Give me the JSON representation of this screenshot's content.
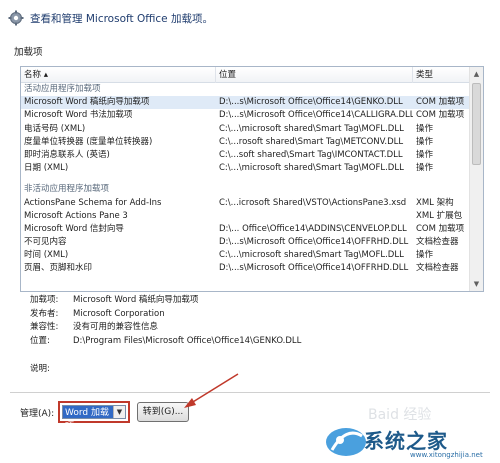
{
  "header": {
    "title": "查看和管理 Microsoft Office 加载项。",
    "icon": "gear-icon"
  },
  "section_label": "加载项",
  "columns": [
    "名称 ▴",
    "位置",
    "类型"
  ],
  "groups": [
    {
      "label": "活动应用程序加载项",
      "rows": [
        {
          "name": "Microsoft Word 稿纸向导加载项",
          "location": "D:\\...s\\Microsoft Office\\Office14\\GENKO.DLL",
          "type": "COM 加载项",
          "selected": true
        },
        {
          "name": "Microsoft Word 书法加载项",
          "location": "D:\\...s\\Microsoft Office\\Office14\\CALLIGRA.DLL",
          "type": "COM 加载项"
        },
        {
          "name": "电话号码 (XML)",
          "location": "C:\\...\\microsoft shared\\Smart Tag\\MOFL.DLL",
          "type": "操作"
        },
        {
          "name": "度量单位转换器 (度量单位转换器)",
          "location": "C:\\...rosoft shared\\Smart Tag\\METCONV.DLL",
          "type": "操作"
        },
        {
          "name": "即时消息联系人 (英语)",
          "location": "C:\\...soft shared\\Smart Tag\\IMCONTACT.DLL",
          "type": "操作"
        },
        {
          "name": "日期 (XML)",
          "location": "C:\\...\\microsoft shared\\Smart Tag\\MOFL.DLL",
          "type": "操作"
        }
      ]
    },
    {
      "label": "非活动应用程序加载项",
      "rows": [
        {
          "name": "ActionsPane Schema for Add-Ins",
          "location": "C:\\...icrosoft Shared\\VSTO\\ActionsPane3.xsd",
          "type": "XML 架构"
        },
        {
          "name": "Microsoft Actions Pane 3",
          "location": "",
          "type": "XML 扩展包"
        },
        {
          "name": "Microsoft Word 信封向导",
          "location": "D:\\... Office\\Office14\\ADDINS\\CENVELOP.DLL",
          "type": "COM 加载项"
        },
        {
          "name": "不可见内容",
          "location": "D:\\...s\\Microsoft Office\\Office14\\OFFRHD.DLL",
          "type": "文档检查器"
        },
        {
          "name": "时间 (XML)",
          "location": "C:\\...\\microsoft shared\\Smart Tag\\MOFL.DLL",
          "type": "操作"
        },
        {
          "name": "页眉、页脚和水印",
          "location": "D:\\...s\\Microsoft Office\\Office14\\OFFRHD.DLL",
          "type": "文档检查器"
        }
      ]
    }
  ],
  "details": [
    {
      "key": "加载项:",
      "value": "Microsoft Word 稿纸向导加载项"
    },
    {
      "key": "发布者:",
      "value": "Microsoft Corporation"
    },
    {
      "key": "兼容性:",
      "value": "没有可用的兼容性信息"
    },
    {
      "key": "位置:",
      "value": "D:\\Program Files\\Microsoft Office\\Office14\\GENKO.DLL"
    }
  ],
  "description_label": "说明:",
  "manage": {
    "label": "管理(A):",
    "selected": "Word 加载项",
    "go_button": "转到(G)..."
  },
  "watermark": {
    "text": "系统之家",
    "sub": "www.xitongzhijia.net",
    "faint": "Baid 经验"
  },
  "colors": {
    "highlight_border": "#c0392b",
    "select_bg": "#316ac5",
    "arrow": "#c0392b"
  }
}
